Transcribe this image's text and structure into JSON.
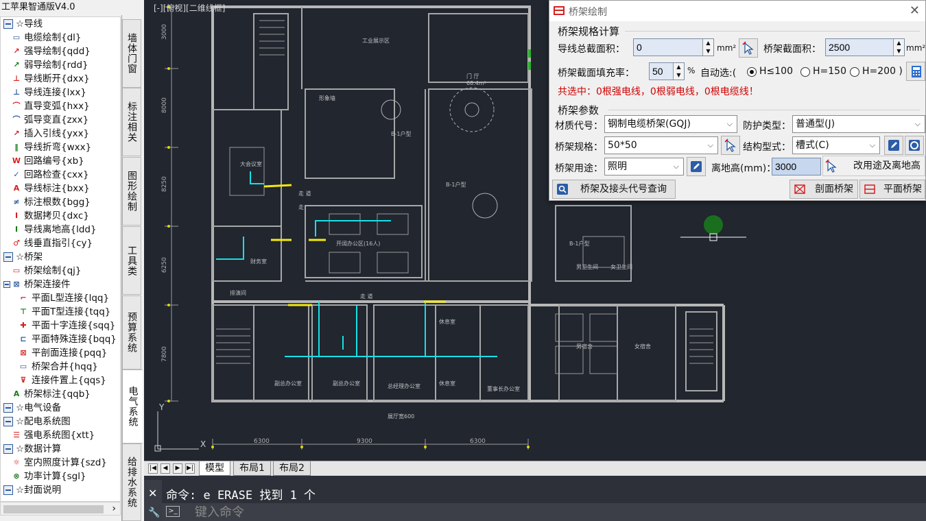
{
  "app": {
    "title": "工苹果智通版V4.0"
  },
  "tree": {
    "items": [
      {
        "label": "☆导线",
        "icon": "folder-icon",
        "level": 0
      },
      {
        "label": "电缆绘制{dl}",
        "icon": "cable-draw-icon",
        "level": 1
      },
      {
        "label": "强导绘制{qdd}",
        "icon": "strong-wire-icon",
        "level": 1
      },
      {
        "label": "弱导绘制{rdd}",
        "icon": "weak-wire-icon",
        "level": 1
      },
      {
        "label": "导线断开{dxx}",
        "icon": "wire-break-icon",
        "level": 1
      },
      {
        "label": "导线连接{lxx}",
        "icon": "wire-connect-icon",
        "level": 1
      },
      {
        "label": "直导变弧{hxx}",
        "icon": "line-to-arc-icon",
        "level": 1
      },
      {
        "label": "弧导变直{zxx}",
        "icon": "arc-to-line-icon",
        "level": 1
      },
      {
        "label": "插入引线{yxx}",
        "icon": "insert-lead-icon",
        "level": 1
      },
      {
        "label": "导线折弯{wxx}",
        "icon": "wire-bend-icon",
        "level": 1
      },
      {
        "label": "回路编号{xb}",
        "icon": "circuit-number-icon",
        "level": 1
      },
      {
        "label": "回路检查{cxx}",
        "icon": "circuit-check-icon",
        "level": 1
      },
      {
        "label": "导线标注{bxx}",
        "icon": "wire-label-icon",
        "level": 1
      },
      {
        "label": "标注根数{bgg}",
        "icon": "count-label-icon",
        "level": 1
      },
      {
        "label": "数据拷贝{dxc}",
        "icon": "data-copy-icon",
        "level": 1
      },
      {
        "label": "导线离地高{ldd}",
        "icon": "wire-height-icon",
        "level": 1
      },
      {
        "label": "线垂直指引{cy}",
        "icon": "vertical-lead-icon",
        "level": 1
      },
      {
        "label": "☆桥架",
        "icon": "folder-icon",
        "level": 0
      },
      {
        "label": "桥架绘制{qj}",
        "icon": "tray-draw-icon",
        "level": 1
      },
      {
        "label": "桥架连接件",
        "icon": "tray-connector-icon",
        "level": 1
      },
      {
        "label": "平面L型连接{lqq}",
        "icon": "l-connect-icon",
        "level": 2
      },
      {
        "label": "平面T型连接{tqq}",
        "icon": "t-connect-icon",
        "level": 2
      },
      {
        "label": "平面十字连接{sqq}",
        "icon": "cross-connect-icon",
        "level": 2
      },
      {
        "label": "平面特殊连接{bqq}",
        "icon": "special-connect-icon",
        "level": 2
      },
      {
        "label": "平剖面连接{pqq}",
        "icon": "section-connect-icon",
        "level": 2
      },
      {
        "label": "桥架合并{hqq}",
        "icon": "tray-merge-icon",
        "level": 2
      },
      {
        "label": "连接件置上{qqs}",
        "icon": "connector-top-icon",
        "level": 2
      },
      {
        "label": "桥架标注{qqb}",
        "icon": "tray-label-icon",
        "level": 1
      },
      {
        "label": "☆电气设备",
        "icon": "folder-icon",
        "level": 0
      },
      {
        "label": "☆配电系统图",
        "icon": "folder-icon",
        "level": 0
      },
      {
        "label": "强电系统图{xtt}",
        "icon": "system-diagram-icon",
        "level": 1
      },
      {
        "label": "☆数据计算",
        "icon": "folder-icon",
        "level": 0
      },
      {
        "label": "室内照度计算{szd}",
        "icon": "illuminance-icon",
        "level": 1
      },
      {
        "label": "功率计算{sgl}",
        "icon": "power-calc-icon",
        "level": 1
      },
      {
        "label": "☆封面说明",
        "icon": "folder-icon",
        "level": 0
      }
    ]
  },
  "vtabs": [
    {
      "label": "墙体门窗"
    },
    {
      "label": "标注相关"
    },
    {
      "label": "图形绘制"
    },
    {
      "label": "工具类"
    },
    {
      "label": "预算系统"
    },
    {
      "label": "电气系统",
      "active": true
    },
    {
      "label": "给排水系统"
    }
  ],
  "cad": {
    "view_label": "[-][俯视][二维线框]",
    "room_labels": [
      "工业展示区",
      "门 厅",
      "68.4m²",
      "形象墙",
      "B-1户型",
      "大会议室",
      "开阔办公区(16人)",
      "财务室",
      "B-1户型",
      "B-1户型",
      "走 道",
      "走 道",
      "排演间",
      "男卫生间",
      "女卫生间",
      "休息室",
      "休息室",
      "副总办公室",
      "副总办公室",
      "总经理办公室",
      "董事长办公室",
      "男宿舍",
      "女宿舍",
      "展厅宽600",
      "走"
    ],
    "dim_top": [
      "6300",
      "9300",
      "6300"
    ],
    "dim_left": [
      "3000",
      "8000",
      "8250",
      "6250",
      "7800"
    ],
    "axis_y": "Y",
    "axis_x": "X"
  },
  "layout_tabs": [
    "模型",
    "布局1",
    "布局2"
  ],
  "command": {
    "history": "命令: e ERASE 找到 1 个",
    "placeholder": "键入命令"
  },
  "dialog": {
    "title": "桥架绘制",
    "spec_group": "桥架规格计算",
    "wire_area_label": "导线总截面积：",
    "wire_area_value": "0",
    "wire_area_unit": "mm²",
    "tray_area_label": "桥架截面积：",
    "tray_area_value": "2500",
    "tray_area_unit": "mm²",
    "fill_rate_label": "桥架截面填充率：",
    "fill_rate_value": "50",
    "fill_rate_unit": "%",
    "auto_select_label": "自动选:(",
    "radio_h100": "H≤100",
    "radio_h150": "H=150",
    "radio_h200": "H=200 )",
    "selected_status": "共选中：0根强电线，0根弱电线，0根电缆线！",
    "param_group": "桥架参数",
    "material_label": "材质代号：",
    "material_value": "钢制电缆桥架(GQJ)",
    "protection_label": "防护类型：",
    "protection_value": "普通型(J)",
    "spec_label": "桥架规格：",
    "spec_value": "50*50",
    "structure_label": "结构型式：",
    "structure_value": "槽式(C)",
    "usage_label": "桥架用途：",
    "usage_value": "照明",
    "height_label": "离地高(mm)：",
    "height_value": "3000",
    "change_button": "改用途及离地高",
    "query_button": "桥架及接头代号查询",
    "section_button": "剖面桥架",
    "plan_button": "平面桥架"
  },
  "colors": {
    "cad_bg": "#21262f",
    "wall": "#b8b8b8",
    "cyan_wire": "#17e0e6",
    "yellow_tray": "#f5ea0a",
    "status_red": "#d00000"
  }
}
